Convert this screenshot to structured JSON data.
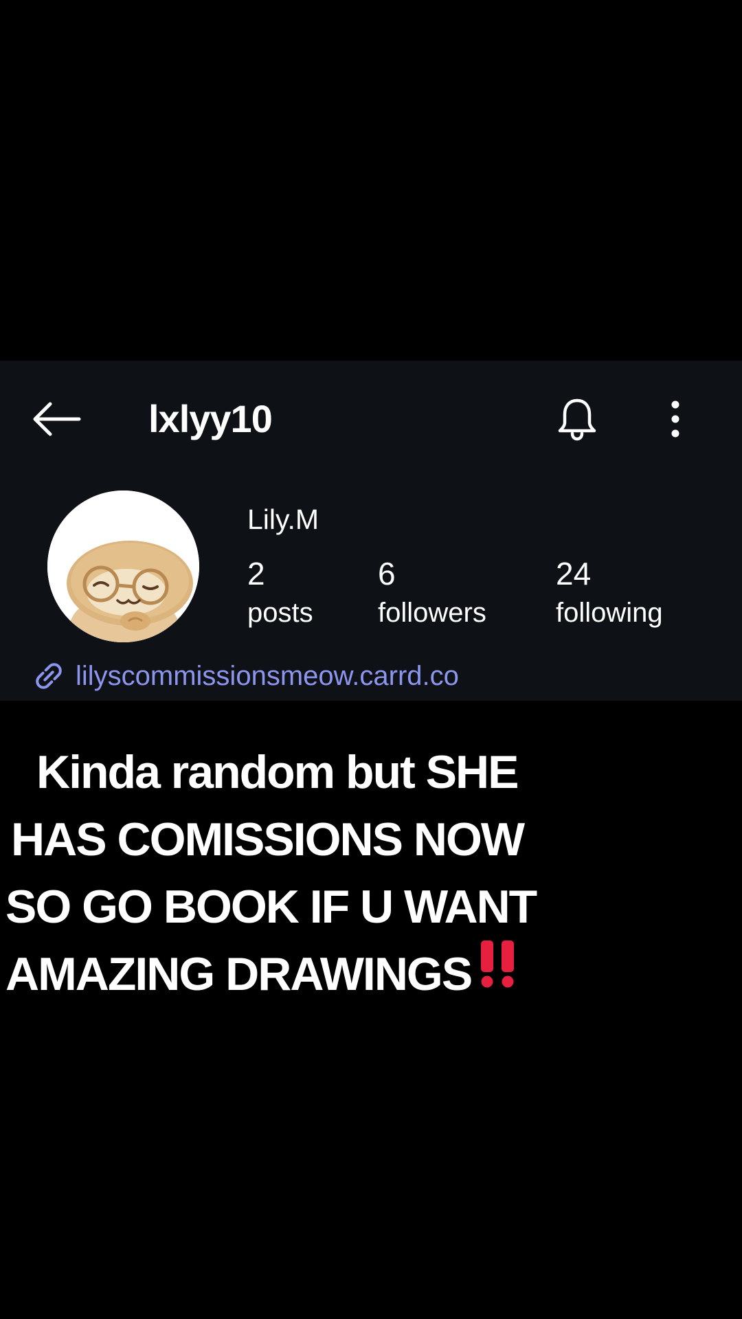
{
  "header": {
    "username": "lxlyy10",
    "back_icon": "arrow-left-icon",
    "bell_icon": "bell-icon",
    "more_icon": "more-vertical-icon"
  },
  "profile": {
    "display_name": "Lily.M",
    "avatar_icon": "cartoon-sloth-with-glasses",
    "stats": [
      {
        "count": "2",
        "label": "posts"
      },
      {
        "count": "6",
        "label": "followers"
      },
      {
        "count": "24",
        "label": "following"
      }
    ],
    "link": {
      "icon": "link-icon",
      "text": "lilyscommissionsmeow.carrd.co"
    }
  },
  "caption": {
    "lines": [
      "Kinda random but SHE",
      "HAS COMISSIONS NOW",
      "SO GO BOOK IF U WANT",
      "AMAZING DRAWINGS"
    ],
    "emoji": "‼️"
  },
  "colors": {
    "background": "#000000",
    "panel": "#0e1116",
    "link": "#8d96ee",
    "text": "#ffffff",
    "emoji_red": "#e8203f"
  }
}
